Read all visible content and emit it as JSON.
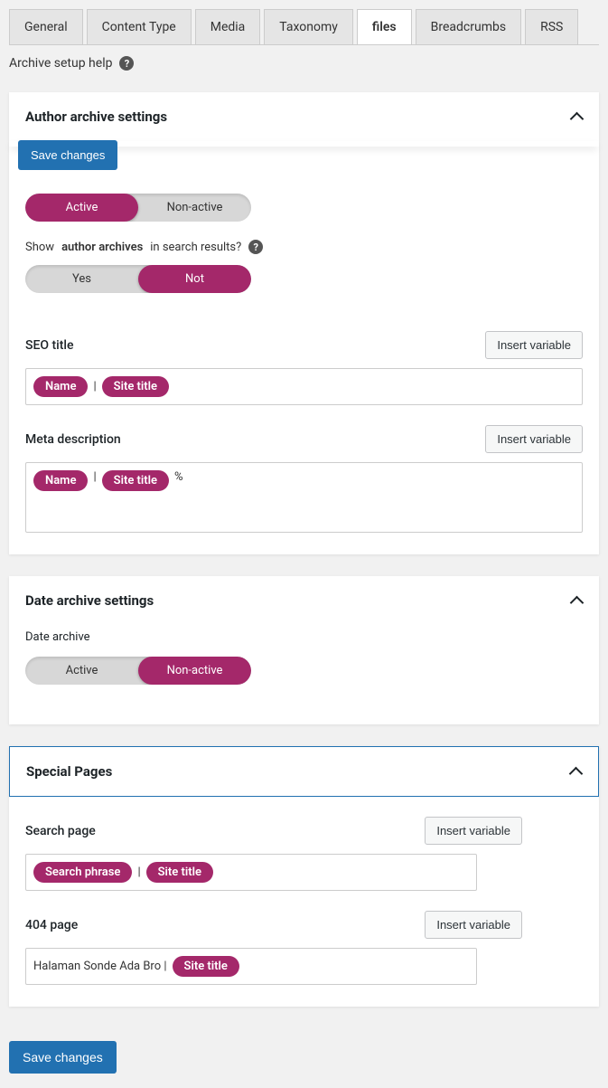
{
  "tabs": {
    "general": "General",
    "content_type": "Content Type",
    "media": "Media",
    "taxonomy": "Taxonomy",
    "files": "files",
    "breadcrumbs": "Breadcrumbs",
    "rss": "RSS"
  },
  "help": {
    "label": "Archive setup help"
  },
  "save_label": "Save changes",
  "author": {
    "title": "Author archive settings",
    "toggle_active": "Active",
    "toggle_nonactive": "Non-active",
    "q_show": "Show",
    "q_author": "author archives",
    "q_in": "in search results?",
    "yes": "Yes",
    "not": "Not",
    "seo_label": "SEO title",
    "insert": "Insert variable",
    "pill_name": "Name",
    "pill_site": "Site title",
    "meta_label": "Meta description",
    "meta_suffix": "%"
  },
  "date": {
    "title": "Date archive settings",
    "subtitle": "Date archive",
    "toggle_active": "Active",
    "toggle_nonactive": "Non-active"
  },
  "special": {
    "title": "Special Pages",
    "search_label": "Search page",
    "insert": "Insert variable",
    "pill_search": "Search phrase",
    "pill_site": "Site title",
    "p404_label": "404 page",
    "p404_text": "Halaman Sonde Ada Bro |",
    "p404_pill": "Site title"
  }
}
